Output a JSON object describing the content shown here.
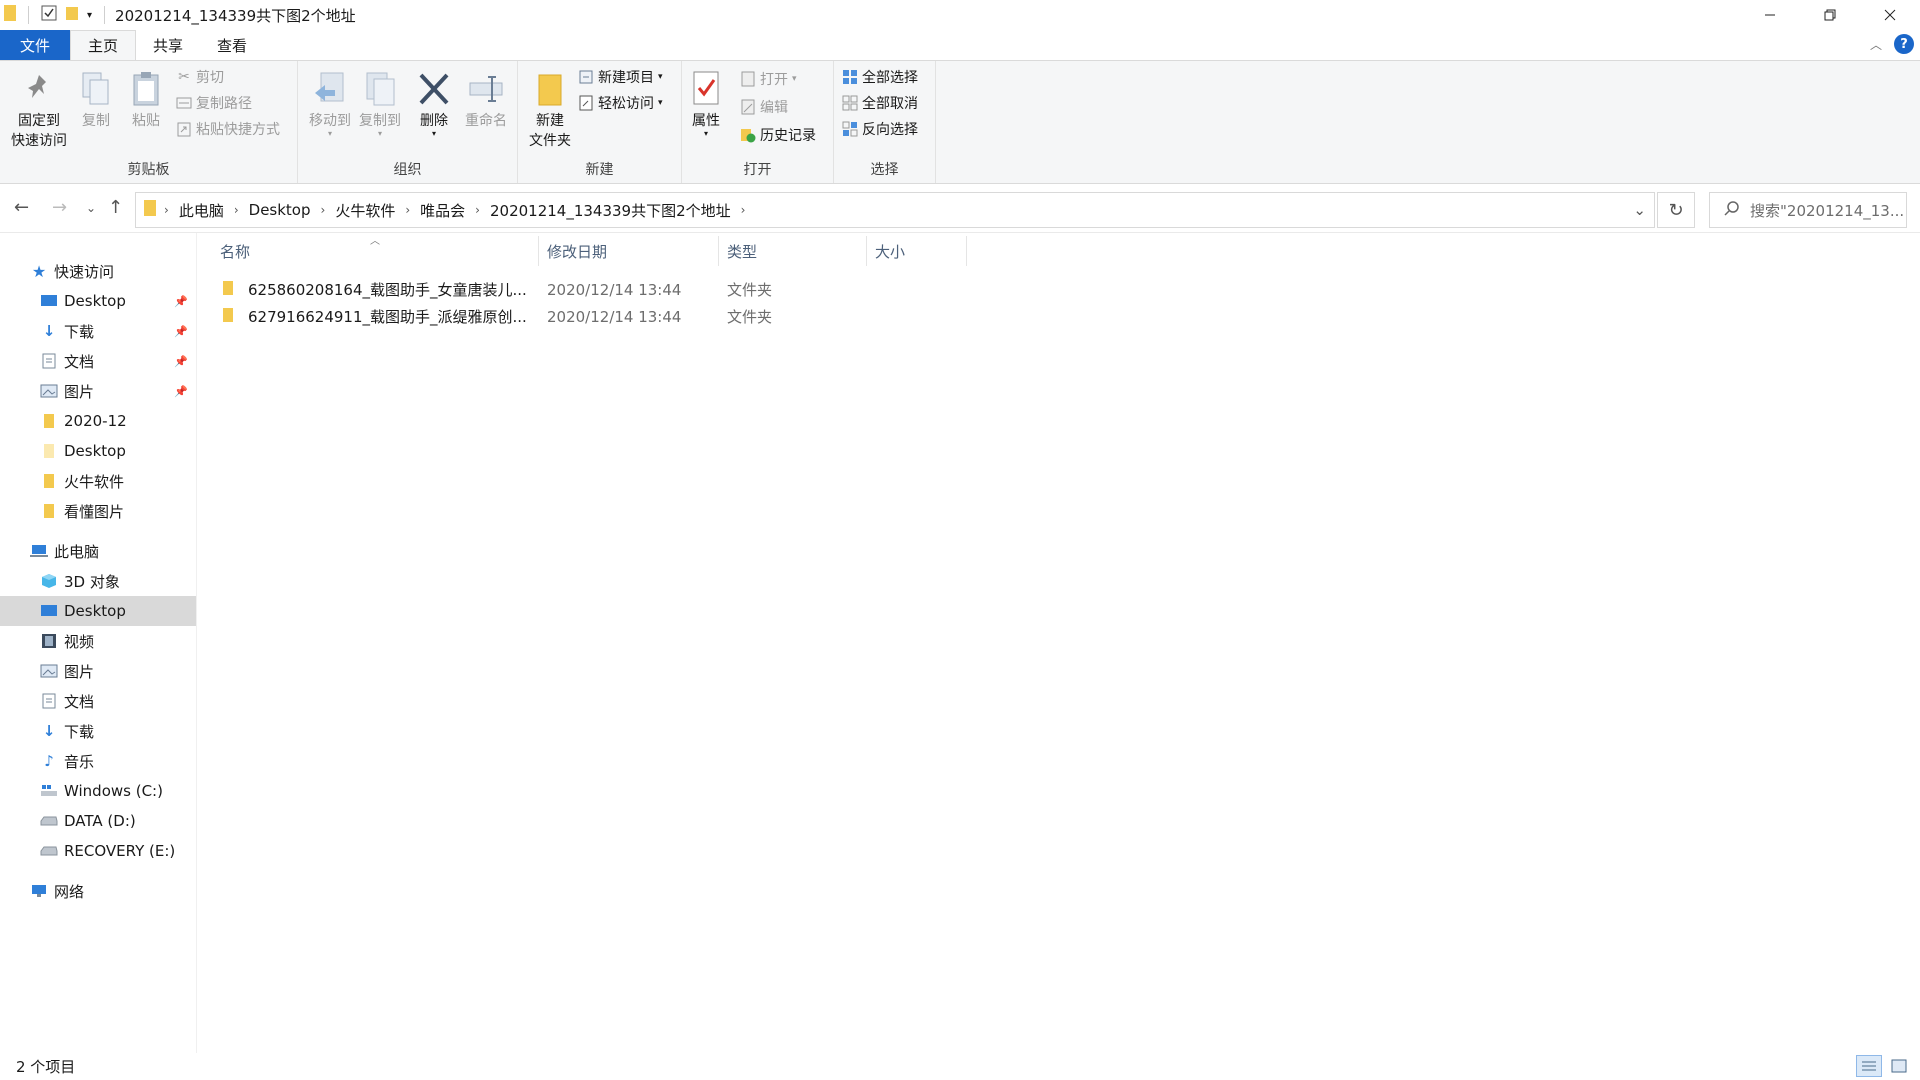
{
  "window": {
    "title": "20201214_134339共下图2个地址",
    "controls": [
      "minimize-icon",
      "restore-icon",
      "close-icon"
    ]
  },
  "tabs": [
    "文件",
    "主页",
    "共享",
    "查看"
  ],
  "ribbon": {
    "clipboard": {
      "label": "剪贴板",
      "pin_line1": "固定到",
      "pin_line2": "快速访问",
      "copy": "复制",
      "paste": "粘贴",
      "cut": "剪切",
      "copy_path": "复制路径",
      "paste_shortcut": "粘贴快捷方式"
    },
    "organize": {
      "label": "组织",
      "move_to": "移动到",
      "copy_to": "复制到",
      "delete": "删除",
      "rename": "重命名"
    },
    "new": {
      "label": "新建",
      "new_folder_line1": "新建",
      "new_folder_line2": "文件夹",
      "new_item": "新建项目",
      "easy_access": "轻松访问"
    },
    "open": {
      "label": "打开",
      "properties": "属性",
      "open": "打开",
      "edit": "编辑",
      "history": "历史记录"
    },
    "select": {
      "label": "选择",
      "select_all": "全部选择",
      "select_none": "全部取消",
      "invert": "反向选择"
    }
  },
  "breadcrumb": [
    "此电脑",
    "Desktop",
    "火牛软件",
    "唯品会",
    "20201214_134339共下图2个地址"
  ],
  "search": {
    "placeholder": "搜索\"20201214_13..."
  },
  "sidebar": {
    "quick_access": "快速访问",
    "quick_items": [
      {
        "label": "Desktop",
        "icon": "desktop-icon",
        "pinned": true
      },
      {
        "label": "下载",
        "icon": "download-icon",
        "pinned": true
      },
      {
        "label": "文档",
        "icon": "document-icon",
        "pinned": true
      },
      {
        "label": "图片",
        "icon": "picture-icon",
        "pinned": true
      },
      {
        "label": "2020-12",
        "icon": "folder-icon",
        "pinned": false
      },
      {
        "label": "Desktop",
        "icon": "folder-icon",
        "pinned": false
      },
      {
        "label": "火牛软件",
        "icon": "folder-icon",
        "pinned": false
      },
      {
        "label": "看懂图片",
        "icon": "folder-icon",
        "pinned": false
      }
    ],
    "this_pc": "此电脑",
    "pc_items": [
      {
        "label": "3D 对象",
        "icon": "cube-icon"
      },
      {
        "label": "Desktop",
        "icon": "desktop-icon",
        "selected": true
      },
      {
        "label": "视频",
        "icon": "video-icon"
      },
      {
        "label": "图片",
        "icon": "picture-icon"
      },
      {
        "label": "文档",
        "icon": "document-icon"
      },
      {
        "label": "下载",
        "icon": "download-icon"
      },
      {
        "label": "音乐",
        "icon": "music-icon"
      },
      {
        "label": "Windows (C:)",
        "icon": "windows-drive-icon"
      },
      {
        "label": "DATA (D:)",
        "icon": "drive-icon"
      },
      {
        "label": "RECOVERY (E:)",
        "icon": "drive-icon"
      }
    ],
    "network": "网络"
  },
  "columns": {
    "name": "名称",
    "modified": "修改日期",
    "type": "类型",
    "size": "大小"
  },
  "files": [
    {
      "name": "625860208164_载图助手_女童唐装儿...",
      "modified": "2020/12/14 13:44",
      "type": "文件夹",
      "size": ""
    },
    {
      "name": "627916624911_载图助手_派缇雅原创...",
      "modified": "2020/12/14 13:44",
      "type": "文件夹",
      "size": ""
    }
  ],
  "status": {
    "item_count": "2 个项目"
  },
  "colors": {
    "accent": "#1a66c9",
    "folder": "#f3c94e",
    "selected_bg": "#d9d9d9"
  }
}
